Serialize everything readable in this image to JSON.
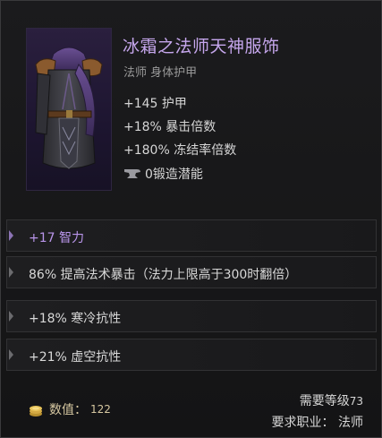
{
  "item": {
    "name": "冰霜之法师天神服饰",
    "type": "法师 身体护甲",
    "image_icon": "robe-armor-icon"
  },
  "base_stats": [
    "+145 护甲",
    "+18% 暴击倍数",
    "+180% 冻结率倍数"
  ],
  "forge": {
    "icon": "anvil-icon",
    "text": "0锻造潜能"
  },
  "affixes": [
    {
      "text": "+17 智力",
      "color": "#b995ea"
    },
    {
      "text": "86% 提高法术暴击（法力上限高于300时翻倍）",
      "color": "#d8d8d8"
    },
    {
      "text": "+18% 寒冷抗性",
      "color": "#d8d8d8"
    },
    {
      "text": "+21% 虚空抗性",
      "color": "#d8d8d8"
    }
  ],
  "footer": {
    "value_label": "数值：",
    "value": "122",
    "value_icon": "coin-stack-icon",
    "level_label": "需要等级",
    "level": "73",
    "class_requirement": "要求职业：  法师"
  }
}
